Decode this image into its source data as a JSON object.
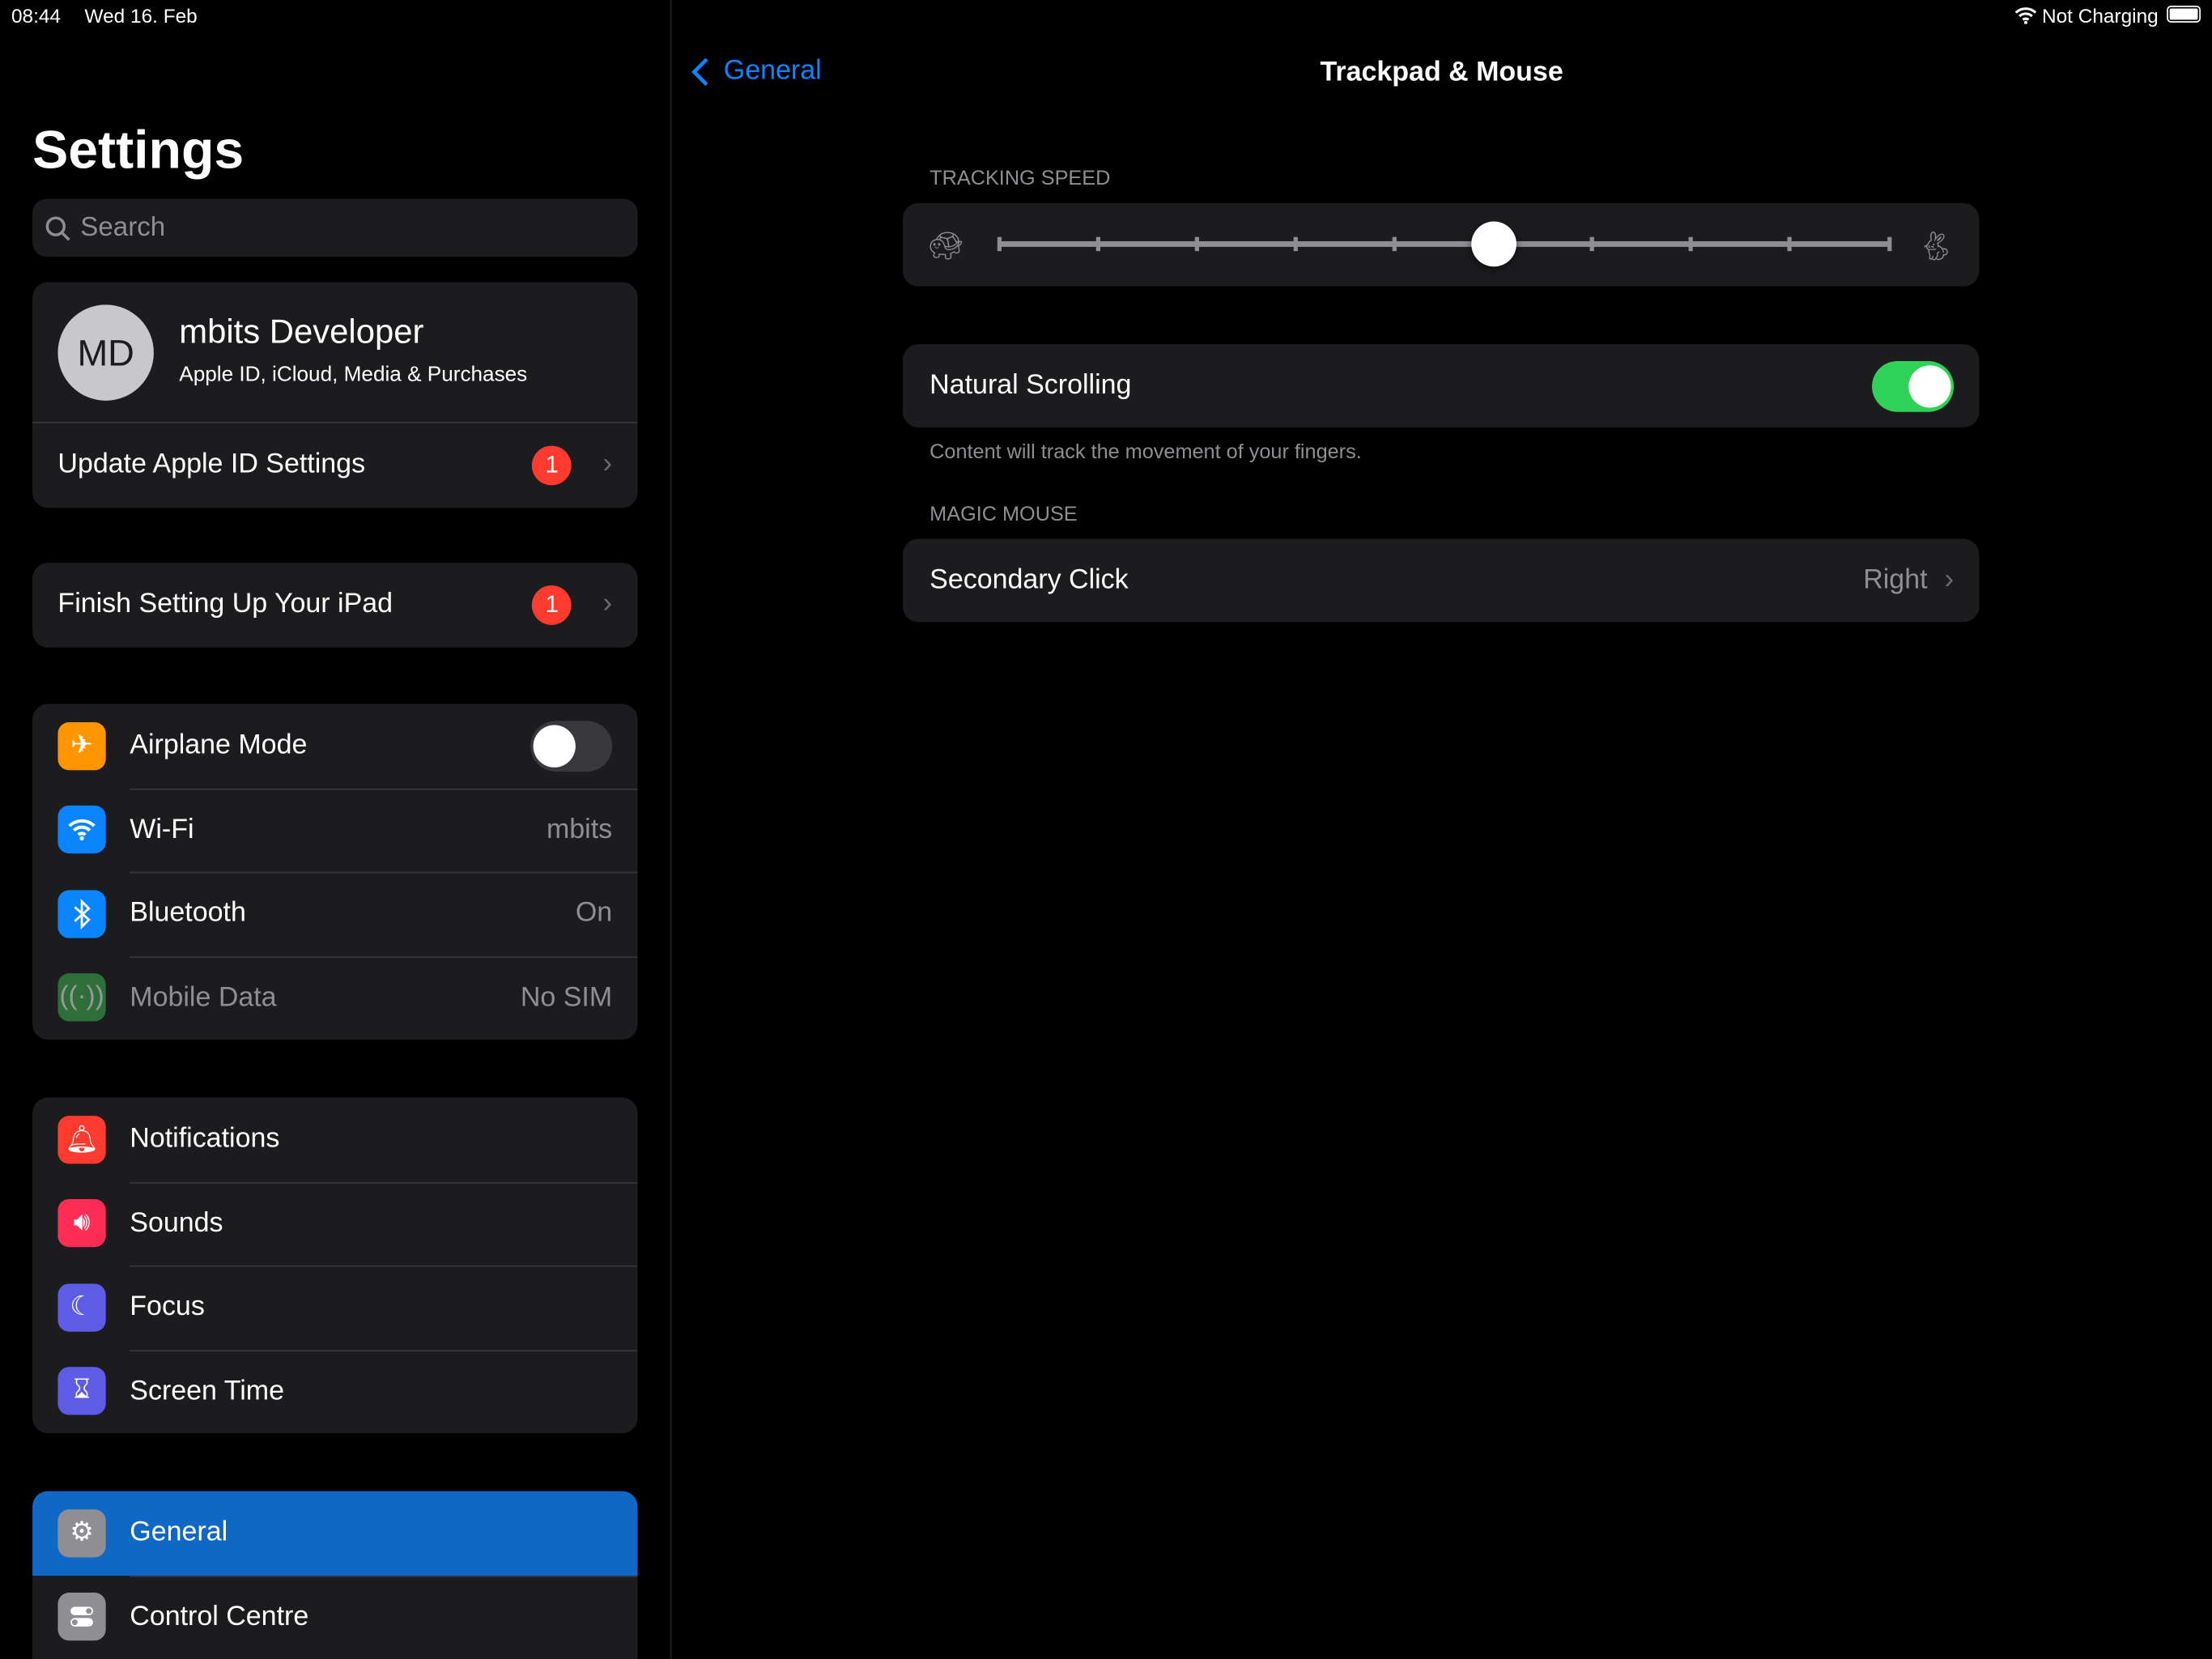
{
  "status": {
    "time": "08:44",
    "date": "Wed 16. Feb",
    "battery": "Not Charging",
    "icons": [
      "wifi-icon",
      "battery-icon"
    ]
  },
  "sidebar": {
    "title": "Settings",
    "search_placeholder": "Search",
    "profile": {
      "initials": "MD",
      "name": "mbits Developer",
      "subtitle": "Apple ID, iCloud, Media & Purchases"
    },
    "update_apple_id": {
      "label": "Update Apple ID Settings",
      "badge": "1"
    },
    "finish_setup": {
      "label": "Finish Setting Up Your iPad",
      "badge": "1"
    },
    "connectivity": [
      {
        "label": "Airplane Mode",
        "icon": "airplane-icon",
        "color": "#ff9500",
        "toggle": false
      },
      {
        "label": "Wi-Fi",
        "icon": "wifi-icon",
        "color": "#0a84ff",
        "value": "mbits"
      },
      {
        "label": "Bluetooth",
        "icon": "bluetooth-icon",
        "color": "#0a84ff",
        "value": "On"
      },
      {
        "label": "Mobile Data",
        "icon": "antenna-icon",
        "color": "#2d6e3a",
        "value": "No SIM",
        "disabled": true
      }
    ],
    "alerts": [
      {
        "label": "Notifications",
        "icon": "bell-icon",
        "color": "#ff3b30"
      },
      {
        "label": "Sounds",
        "icon": "speaker-icon",
        "color": "#ff2d55"
      },
      {
        "label": "Focus",
        "icon": "moon-icon",
        "color": "#5e5ce6"
      },
      {
        "label": "Screen Time",
        "icon": "hourglass-icon",
        "color": "#5e5ce6"
      }
    ],
    "system": [
      {
        "label": "General",
        "icon": "gear-icon",
        "color": "#8e8e93",
        "selected": true
      },
      {
        "label": "Control Centre",
        "icon": "switches-icon",
        "color": "#8e8e93"
      }
    ],
    "selected_color": "#0f67c6"
  },
  "main": {
    "back_label": "General",
    "title": "Trackpad & Mouse",
    "tracking_header": "TRACKING SPEED",
    "tracking_speed": {
      "value": 5,
      "min": 0,
      "max": 9,
      "fraction": 0.556
    },
    "natural_scrolling": {
      "label": "Natural Scrolling",
      "on": true,
      "footer": "Content will track the movement of your fingers."
    },
    "magic_header": "MAGIC MOUSE",
    "secondary_click": {
      "label": "Secondary Click",
      "value": "Right"
    },
    "accent": "#0a84ff",
    "toggle_on": "#30d158"
  }
}
